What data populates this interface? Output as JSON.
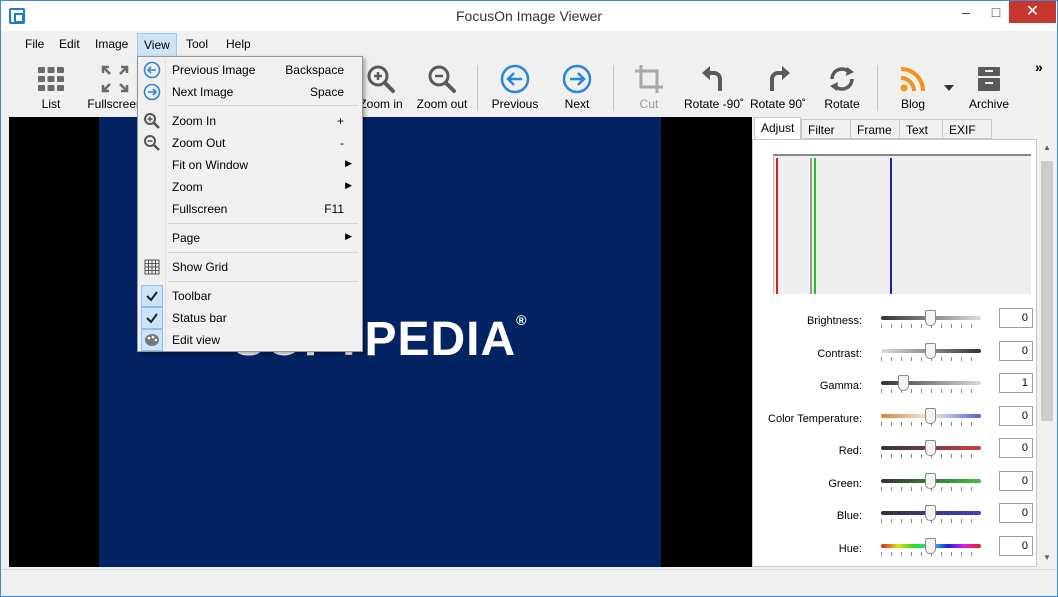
{
  "window": {
    "title": "FocusOn Image Viewer",
    "min": "–",
    "max": "□",
    "close": "✕"
  },
  "menubar": [
    "File",
    "Edit",
    "Image",
    "View",
    "Tool",
    "Help"
  ],
  "toolbar": {
    "list": "List",
    "fullscreen": "Fullscreen",
    "zoom_in": "Zoom in",
    "zoom_out": "Zoom out",
    "previous": "Previous",
    "next": "Next",
    "cut": "Cut",
    "rotate_left": "Rotate -90˚",
    "rotate_right": "Rotate 90˚",
    "rotate": "Rotate",
    "blog": "Blog",
    "archive": "Archive",
    "overflow": "»"
  },
  "image": {
    "brand": "SOFTPEDIA",
    "reg": "®",
    "bg": "#042363"
  },
  "panel": {
    "tabs": [
      "Adjust",
      "Filter",
      "Frame",
      "Text",
      "EXIF"
    ],
    "adjustments": [
      {
        "label": "Brightness:",
        "value": "0"
      },
      {
        "label": "Contrast:",
        "value": "0"
      },
      {
        "label": "Gamma:",
        "value": "1"
      },
      {
        "label": "Color Temperature:",
        "value": "0"
      },
      {
        "label": "Red:",
        "value": "0"
      },
      {
        "label": "Green:",
        "value": "0"
      },
      {
        "label": "Blue:",
        "value": "0"
      },
      {
        "label": "Hue:",
        "value": "0"
      }
    ]
  },
  "view_menu": {
    "previous_image": {
      "label": "Previous Image",
      "shortcut": "Backspace"
    },
    "next_image": {
      "label": "Next Image",
      "shortcut": "Space"
    },
    "zoom_in": {
      "label": "Zoom In",
      "shortcut": "+"
    },
    "zoom_out": {
      "label": "Zoom Out",
      "shortcut": "-"
    },
    "fit_on_window": {
      "label": "Fit on Window"
    },
    "zoom": {
      "label": "Zoom"
    },
    "fullscreen": {
      "label": "Fullscreen",
      "shortcut": "F11"
    },
    "page": {
      "label": "Page"
    },
    "show_grid": {
      "label": "Show Grid"
    },
    "toolbar": {
      "label": "Toolbar",
      "checked": true
    },
    "status_bar": {
      "label": "Status bar",
      "checked": true
    },
    "edit_view": {
      "label": "Edit view",
      "checked": true
    }
  },
  "colors": {
    "accent": "#1e7bd0",
    "close": "#c7352c",
    "histogram_red": "#d02020",
    "histogram_green": "#20c020",
    "histogram_blue": "#2020b0"
  }
}
